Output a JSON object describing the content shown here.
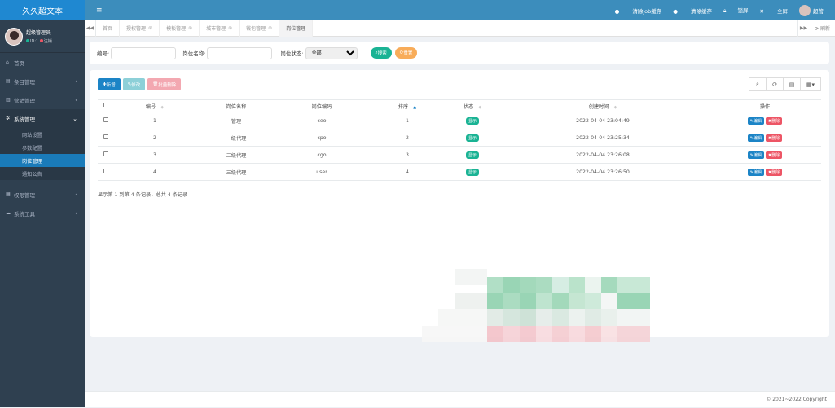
{
  "app": {
    "logo": "久久超文本"
  },
  "profile": {
    "name": "超级管理员",
    "id_text": "ID:1",
    "logout": "注销"
  },
  "sidebar": {
    "items": [
      {
        "label": "首页",
        "icon": "home-icon"
      },
      {
        "label": "条目管理",
        "icon": "list-icon"
      },
      {
        "label": "营销管理",
        "icon": "bank-icon"
      },
      {
        "label": "系统管理",
        "icon": "gear-icon",
        "active": true
      },
      {
        "label": "权限管理",
        "icon": "grid-icon"
      },
      {
        "label": "系统工具",
        "icon": "cloud-icon"
      }
    ],
    "sub": [
      {
        "label": "网站设置"
      },
      {
        "label": "参数配置"
      },
      {
        "label": "岗位管理",
        "active": true
      },
      {
        "label": "通知公告"
      }
    ]
  },
  "topbar": {
    "clear_job": "清除job缓存",
    "clear_cache": "清除缓存",
    "lock": "锁屏",
    "fullscreen": "全屏",
    "user": "超管"
  },
  "tabs": [
    {
      "label": "首页",
      "closable": false
    },
    {
      "label": "授权管理"
    },
    {
      "label": "模板管理"
    },
    {
      "label": "城市管理"
    },
    {
      "label": "钱包管理"
    },
    {
      "label": "岗位管理",
      "active": true
    }
  ],
  "tabs_refresh": "刷新",
  "search": {
    "code_label": "编号:",
    "name_label": "岗位名称:",
    "status_label": "岗位状态:",
    "status_value": "全部",
    "search_btn": "搜索",
    "reset_btn": "重置"
  },
  "toolbar": {
    "add": "新增",
    "edit": "修改",
    "delete": "批量删除"
  },
  "table": {
    "headers": [
      "编号",
      "岗位名称",
      "岗位编码",
      "排序",
      "状态",
      "创建时间",
      "操作"
    ],
    "rows": [
      {
        "id": "1",
        "name": "管理",
        "code": "ceo",
        "sort": "1",
        "status": "显示",
        "time": "2022-04-04 23:04:49"
      },
      {
        "id": "2",
        "name": "一级代理",
        "code": "cpo",
        "sort": "2",
        "status": "显示",
        "time": "2022-04-04 23:25:34"
      },
      {
        "id": "3",
        "name": "二级代理",
        "code": "cgo",
        "sort": "3",
        "status": "显示",
        "time": "2022-04-04 23:26:08"
      },
      {
        "id": "4",
        "name": "三级代理",
        "code": "user",
        "sort": "4",
        "status": "显示",
        "time": "2022-04-04 23:26:50"
      }
    ],
    "op_edit": "编辑",
    "op_delete": "删除",
    "page_info": "显示第 1 到第 4 条记录，总共 4 条记录"
  },
  "footer": {
    "copyright": "© 2021~2022 Copyright"
  },
  "colors": {
    "sidebar": "#2f4050",
    "topbar": "#3c8dbc",
    "primary": "#1c84c6",
    "success": "#1ab394",
    "danger": "#ed5565",
    "warning": "#f8ac59"
  }
}
